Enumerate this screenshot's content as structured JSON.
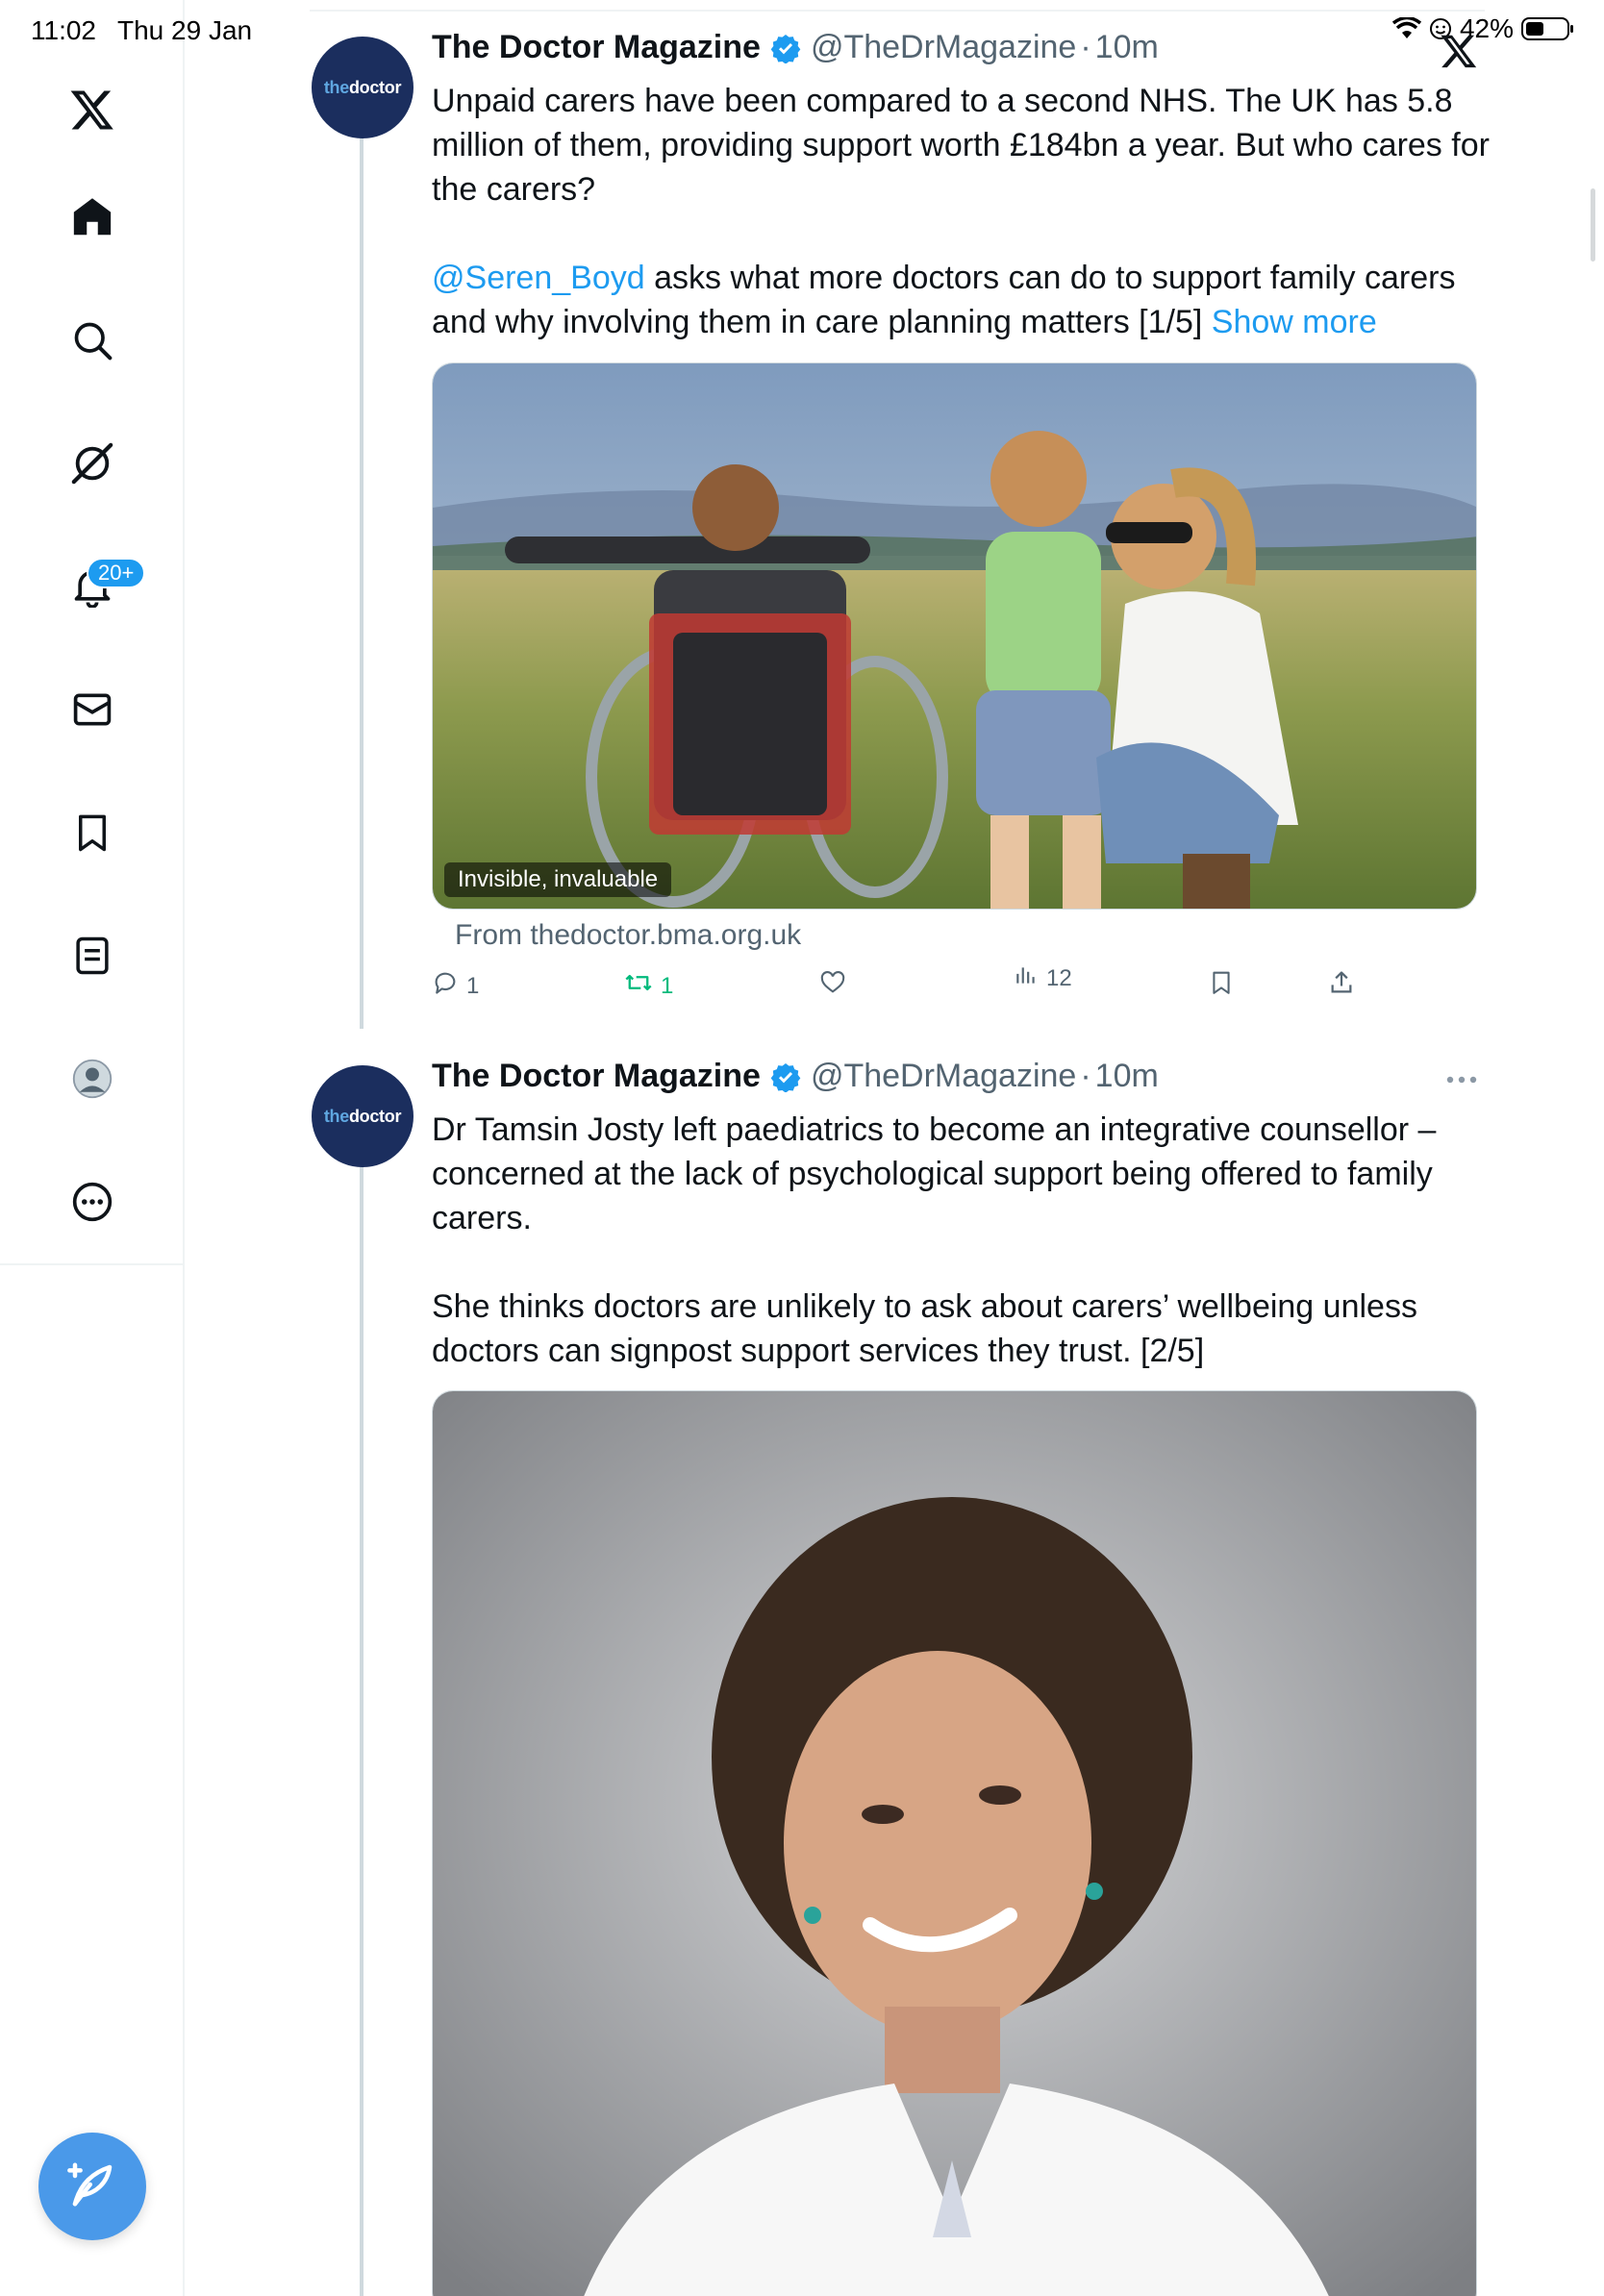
{
  "status_bar": {
    "time": "11:02",
    "date": "Thu 29 Jan",
    "battery_pct": "42%"
  },
  "sidebar": {
    "items": [
      {
        "name": "home",
        "icon": "home-icon"
      },
      {
        "name": "explore",
        "icon": "search-icon"
      },
      {
        "name": "grok",
        "icon": "grok-icon"
      },
      {
        "name": "notifications",
        "icon": "bell-icon",
        "badge": "20+"
      },
      {
        "name": "messages",
        "icon": "envelope-icon"
      },
      {
        "name": "bookmarks",
        "icon": "bookmark-icon"
      },
      {
        "name": "lists",
        "icon": "list-icon"
      },
      {
        "name": "profile",
        "icon": "profile-icon"
      },
      {
        "name": "more",
        "icon": "more-circle-icon"
      }
    ],
    "compose_icon": "compose-icon"
  },
  "tweets": [
    {
      "avatar_text_a": "the",
      "avatar_text_b": "doctor",
      "name": "The Doctor Magazine",
      "handle": "@TheDrMagazine",
      "dot": "·",
      "time": "10m",
      "text_p1": "Unpaid carers have been compared to a second NHS. The UK has 5.8 million of them, providing support worth £184bn a year. But who cares for the carers?",
      "mention": "@Seren_Boyd",
      "text_p2_rest": " asks what more doctors can do to support family carers and why involving them in care planning matters [1/5] ",
      "show_more": "Show more",
      "media_caption": "Invisible, invaluable",
      "source": "From thedoctor.bma.org.uk",
      "replies": "1",
      "reposts": "1",
      "views": "12"
    },
    {
      "avatar_text_a": "the",
      "avatar_text_b": "doctor",
      "name": "The Doctor Magazine",
      "handle": "@TheDrMagazine",
      "dot": "·",
      "time": "10m",
      "text_p1": "Dr Tamsin Josty left paediatrics to become an integrative counsellor – concerned at the lack of psychological support being offered to family carers.",
      "text_p2": "She thinks doctors are unlikely to ask about carers’ wellbeing unless doctors can signpost support services they trust. [2/5]"
    }
  ],
  "colors": {
    "accent": "#1d9bf0",
    "repost": "#00ba7c",
    "avatar_bg": "#1b2e5e",
    "fab": "#4a99e9"
  }
}
